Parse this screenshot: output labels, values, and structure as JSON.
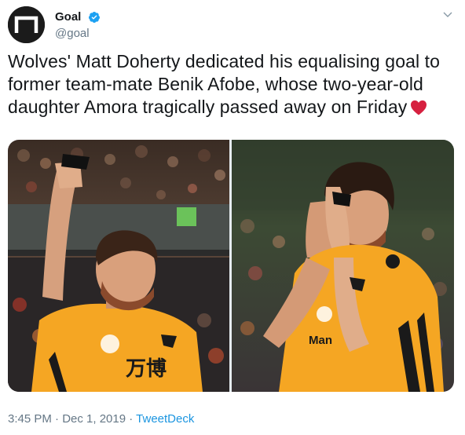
{
  "account": {
    "display_name": "Goal",
    "handle": "@goal",
    "verified": true
  },
  "icons": {
    "avatar": "goal-logo",
    "verified": "verified-badge-icon",
    "menu": "chevron-down-icon",
    "emoji": "red-heart-icon"
  },
  "tweet": {
    "text_line1": "Wolves' Matt Doherty dedicated his equalising goal to",
    "text_line2": "former team-mate Benik Afobe, whose two-year-old",
    "text_line3": "daughter Amora tragically passed away on Friday",
    "timestamp": "3:45 PM · Dec 1, 2019",
    "separator": " · ",
    "source": "TweetDeck"
  },
  "colors": {
    "text": "#14171a",
    "secondary": "#657786",
    "link": "#1b95e0",
    "verified": "#1da1f2",
    "heart": "#e0245e",
    "kit_orange": "#f5a623"
  }
}
